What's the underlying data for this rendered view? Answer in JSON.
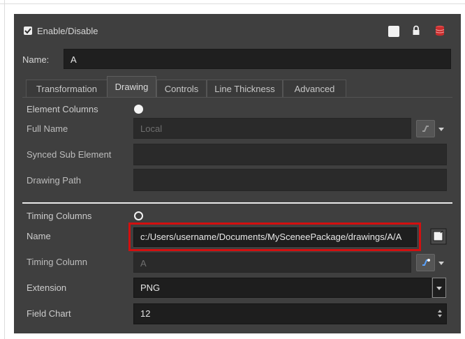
{
  "header": {
    "enable_label": "Enable/Disable",
    "enabled": true,
    "icons": [
      "square-icon",
      "lock-icon",
      "database-icon"
    ]
  },
  "name_row": {
    "label": "Name:",
    "value": "A"
  },
  "tabs": [
    {
      "label": "Transformation",
      "active": false
    },
    {
      "label": "Drawing",
      "active": true
    },
    {
      "label": "Controls",
      "active": false
    },
    {
      "label": "Line Thickness",
      "active": false
    },
    {
      "label": "Advanced",
      "active": false
    }
  ],
  "element": {
    "columns_label": "Element Columns",
    "full_name_label": "Full Name",
    "full_name_value": "Local",
    "synced_label": "Synced Sub Element",
    "synced_value": "",
    "drawing_path_label": "Drawing Path",
    "drawing_path_value": ""
  },
  "timing": {
    "columns_label": "Timing Columns",
    "name_label": "Name",
    "name_value": "c:/Users/username/Documents/MySceneePackage/drawings/A/A",
    "timing_column_label": "Timing Column",
    "timing_column_value": "A",
    "extension_label": "Extension",
    "extension_value": "PNG",
    "field_chart_label": "Field Chart",
    "field_chart_value": "12"
  },
  "colors": {
    "panel": "#3f3f3f",
    "highlight": "#d30f0f"
  }
}
